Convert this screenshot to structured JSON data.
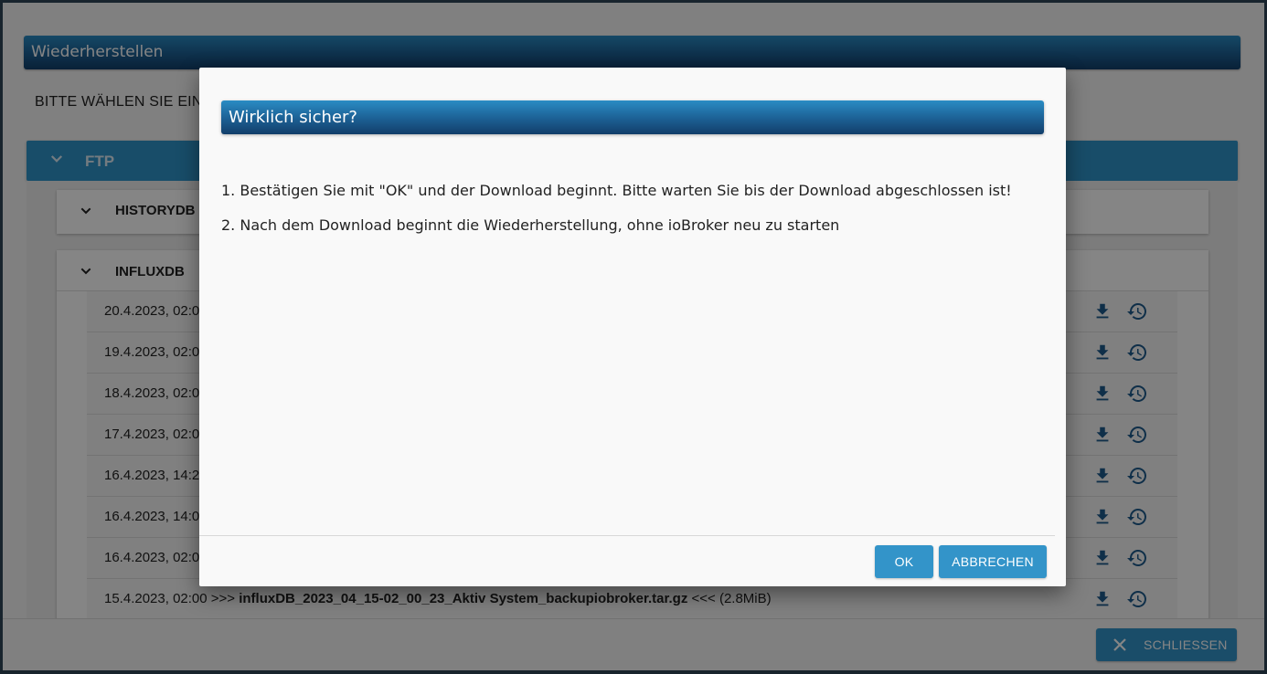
{
  "background": {
    "header_title": "Wiederherstellen",
    "subtitle": "BITTE WÄHLEN SIE EIN B",
    "ftp_label": "FTP",
    "panels": [
      {
        "label": "HISTORYDB"
      },
      {
        "label": "INFLUXDB"
      }
    ],
    "rows": [
      {
        "date": "20.4.2023, 02:0",
        "file": "",
        "size": ""
      },
      {
        "date": "19.4.2023, 02:0",
        "file": "",
        "size": ""
      },
      {
        "date": "18.4.2023, 02:0",
        "file": "",
        "size": ""
      },
      {
        "date": "17.4.2023, 02:0",
        "file": "",
        "size": ""
      },
      {
        "date": "16.4.2023, 14:2",
        "file": "",
        "size": ""
      },
      {
        "date": "16.4.2023, 14:0",
        "file": "",
        "size": ""
      },
      {
        "date": "16.4.2023, 02:0",
        "file": "",
        "size": ""
      },
      {
        "date": "15.4.2023, 02:00 >>> ",
        "file": "influxDB_2023_04_15-02_00_23_Aktiv System_backupiobroker.tar.gz",
        "size": " <<< (2.8MiB)"
      }
    ],
    "close_label": "SCHLIESSEN"
  },
  "dialog": {
    "title": "Wirklich sicher?",
    "line1": "1. Bestätigen Sie mit \"OK\" und der Download beginnt. Bitte warten Sie bis der Download abgeschlossen ist!",
    "line2": "2. Nach dem Download beginnt die Wiederherstellung, ohne ioBroker neu zu starten",
    "ok_label": "OK",
    "cancel_label": "ABBRECHEN"
  },
  "colors": {
    "accent": "#3394c9",
    "header_dark": "#123e6a",
    "icon": "#1e5a8c"
  }
}
